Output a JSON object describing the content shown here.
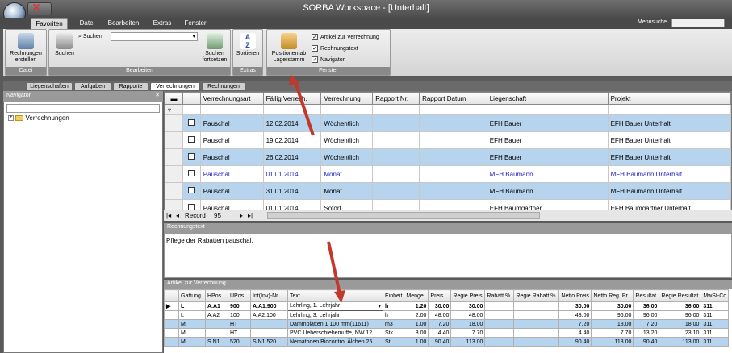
{
  "window": {
    "title": "SORBA Workspace - [Unterhalt]"
  },
  "ribbon_tabs": [
    "Favoriten",
    "Datei",
    "Bearbeiten",
    "Extras",
    "Fenster"
  ],
  "menusuche": {
    "label": "Menusuche",
    "value": ""
  },
  "ribbon": {
    "datei": {
      "label": "Datei",
      "rechnungen": "Rechnungen erstellen"
    },
    "bearbeiten": {
      "label": "Bearbeiten",
      "suchen": "Suchen",
      "suchen_small": "Suchen",
      "suchen_fortsetzen": "Suchen fortsetzen"
    },
    "extras": {
      "label": "Extras",
      "sortieren": "Sortieren"
    },
    "fenster": {
      "label": "Fenster",
      "positionen": "Positionen ab Lagerstamm",
      "checks": [
        "Artikel zur Verrechnung",
        "Rechnungstext",
        "Navigator"
      ]
    }
  },
  "doc_tabs": [
    "Liegenschaften",
    "Aufgaben",
    "Rapporte",
    "Verrechnungen",
    "Rechnungen"
  ],
  "navigator": {
    "title": "Navigator",
    "tree_item": "Verrechnungen"
  },
  "grid": {
    "columns": [
      "Verrechnungsart",
      "Fällig Verrech.",
      "Verrechnung",
      "Rapport Nr.",
      "Rapport Datum",
      "Liegenschaft",
      "Projekt"
    ],
    "rows": [
      {
        "art": "Pauschal",
        "faellig": "12.02.2014",
        "verrechnung": "Wöchentlich",
        "rnr": "",
        "rdatum": "",
        "liegenschaft": "EFH Bauer",
        "projekt": "EFH Bauer Unterhalt"
      },
      {
        "art": "Pauschal",
        "faellig": "19.02.2014",
        "verrechnung": "Wöchentlich",
        "rnr": "",
        "rdatum": "",
        "liegenschaft": "EFH Bauer",
        "projekt": "EFH Bauer Unterhalt"
      },
      {
        "art": "Pauschal",
        "faellig": "26.02.2014",
        "verrechnung": "Wöchentlich",
        "rnr": "",
        "rdatum": "",
        "liegenschaft": "EFH Bauer",
        "projekt": "EFH Bauer Unterhalt"
      },
      {
        "art": "Pauschal",
        "faellig": "01.01.2014",
        "verrechnung": "Monat",
        "rnr": "",
        "rdatum": "",
        "liegenschaft": "MFH Baumann",
        "projekt": "MFH Baumann Unterhalt"
      },
      {
        "art": "Pauschal",
        "faellig": "31.01.2014",
        "verrechnung": "Monat",
        "rnr": "",
        "rdatum": "",
        "liegenschaft": "MFH Baumann",
        "projekt": "MFH Baumann Unterhalt"
      },
      {
        "art": "Pauschal",
        "faellig": "01.01.2014",
        "verrechnung": "Sofort",
        "rnr": "",
        "rdatum": "",
        "liegenschaft": "EFH Baumgartner",
        "projekt": "EFH Baumgartner Unterhalt"
      }
    ],
    "record_label": "Record",
    "record_value": "95"
  },
  "rechnungstext": {
    "title": "Rechnungstext",
    "text": "Pflege der Rabatten pauschal."
  },
  "artikel": {
    "title": "Artikel zur Verrechnung",
    "columns": [
      "Gattung",
      "HPos",
      "UPos",
      "Int(Inv)-Nr.",
      "Text",
      "Einheit",
      "Menge",
      "Preis",
      "Regie Preis",
      "Rabatt %",
      "Regie Rabatt %",
      "Netto Preis",
      "Netto Reg. Pr.",
      "Resultat",
      "Regie Resultat",
      "MwSt-Co"
    ],
    "rows": [
      [
        "L",
        "A.A1",
        "900",
        "A.A1.900",
        "Lehrling, 1. Lehrjahr",
        "h",
        "1.20",
        "30.00",
        "30.00",
        "",
        "",
        "30.00",
        "30.00",
        "36.00",
        "36.00",
        "311"
      ],
      [
        "L",
        "A.A2",
        "100",
        "A.A2.100",
        "Lehrling, 3. Lehrjahr",
        "h",
        "2.00",
        "48.00",
        "48.00",
        "",
        "",
        "48.00",
        "96.00",
        "96.00",
        "96.00",
        "311"
      ],
      [
        "M",
        "",
        "HT",
        "",
        "Dämmplatten 1 100 mm(11611)",
        "m3",
        "1.00",
        "7.20",
        "18.00",
        "",
        "",
        "7.20",
        "18.00",
        "7.20",
        "18.00",
        "311"
      ],
      [
        "M",
        "",
        "HT",
        "",
        "PVC Ueberschiebemuffe, NW 12",
        "Stk",
        "3.00",
        "4.40",
        "7.70",
        "",
        "",
        "4.40",
        "7.70",
        "13.20",
        "23.10",
        "311"
      ],
      [
        "M",
        "S.N1",
        "520",
        "S.N1.520",
        "Nematoden Biocontrol Älchen 25",
        "St",
        "1.00",
        "90.40",
        "113.00",
        "",
        "",
        "90.40",
        "113.00",
        "90.40",
        "113.00",
        "311"
      ]
    ]
  }
}
